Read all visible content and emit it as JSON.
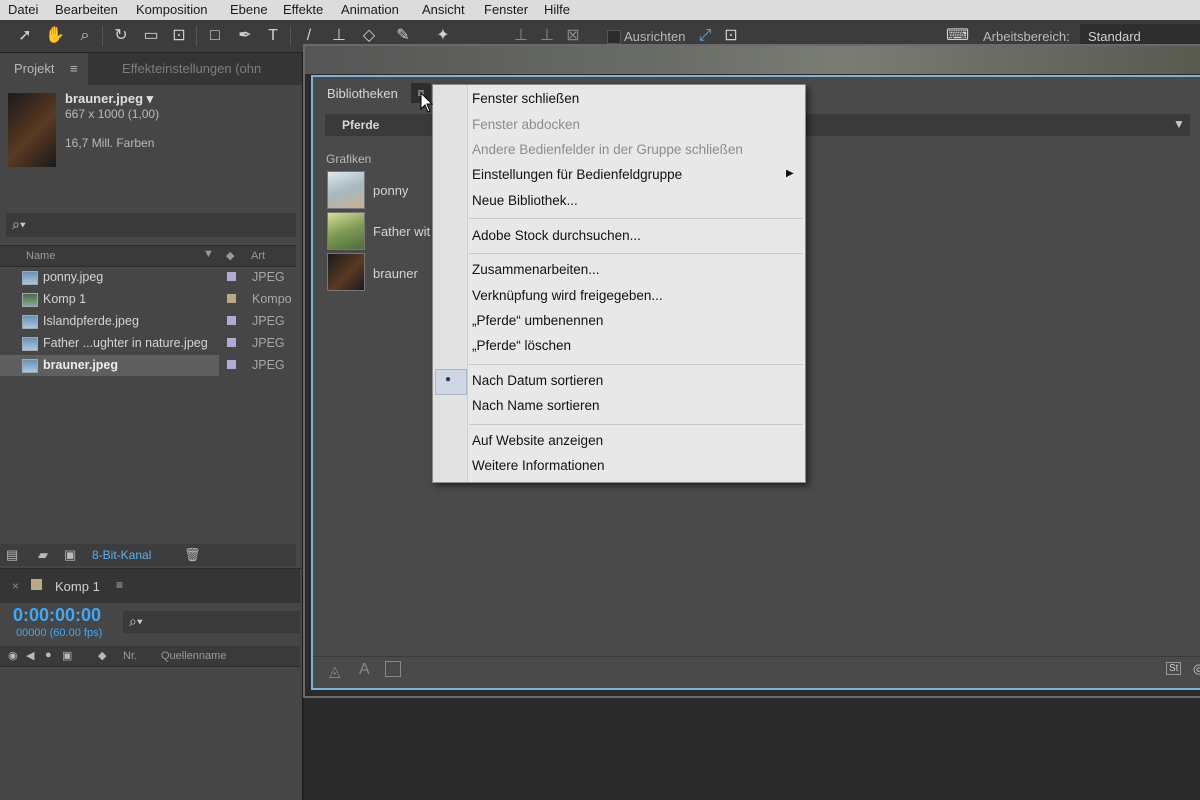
{
  "menubar": {
    "items": [
      "Datei",
      "Bearbeiten",
      "Komposition",
      "Ebene",
      "Effekte",
      "Animation",
      "Ansicht",
      "Fenster",
      "Hilfe"
    ]
  },
  "toolbar": {
    "align_label": "Ausrichten",
    "workspace_label": "Arbeitsbereich:",
    "workspace_value": "Standard"
  },
  "project": {
    "tab_project": "Projekt",
    "tab_effects": "Effekteinstellungen (ohn",
    "preview_name": "brauner.jpeg ▾",
    "preview_dims": "667 x 1000 (1,00)",
    "preview_colors": "16,7 Mill. Farben",
    "search_icon": "search-icon",
    "col_name": "Name",
    "col_type": "Art",
    "files": [
      {
        "name": "ponny.jpeg",
        "type": "JPEG"
      },
      {
        "name": "Komp 1",
        "type": "Kompo"
      },
      {
        "name": "Islandpferde.jpeg",
        "type": "JPEG"
      },
      {
        "name": "Father ...ughter in nature.jpeg",
        "type": "JPEG"
      },
      {
        "name": "brauner.jpeg",
        "type": "JPEG"
      }
    ],
    "bit_depth": "8-Bit-Kanal"
  },
  "timeline": {
    "comp_tab": "Komp 1",
    "timecode": "0:00:00:00",
    "frames": "00000 (60.00 fps)",
    "col_nr": "Nr.",
    "col_source": "Quellenname"
  },
  "libraries": {
    "title": "Bibliotheken",
    "selected_library": "Pferde",
    "section": "Grafiken",
    "items": [
      "ponny",
      "Father wit",
      "brauner"
    ]
  },
  "context_menu": {
    "items": [
      {
        "label": "Fenster schließen",
        "disabled": false
      },
      {
        "label": "Fenster abdocken",
        "disabled": true
      },
      {
        "label": "Andere Bedienfelder in der Gruppe schließen",
        "disabled": true
      },
      {
        "label": "Einstellungen für Bedienfeldgruppe",
        "disabled": false,
        "submenu": true
      },
      {
        "label": "Neue Bibliothek...",
        "disabled": false
      },
      {
        "label": "Adobe Stock durchsuchen...",
        "disabled": false
      },
      {
        "label": "Zusammenarbeiten...",
        "disabled": false
      },
      {
        "label": "Verknüpfung wird freigegeben...",
        "disabled": false
      },
      {
        "label": "„Pferde“ umbenennen",
        "disabled": false
      },
      {
        "label": "„Pferde“ löschen",
        "disabled": false
      },
      {
        "label": "Nach Datum sortieren",
        "disabled": false,
        "checked": true
      },
      {
        "label": "Nach Name sortieren",
        "disabled": false
      },
      {
        "label": "Auf Website anzeigen",
        "disabled": false
      },
      {
        "label": "Weitere Informationen",
        "disabled": false
      }
    ]
  },
  "colors": {
    "accent_blue": "#3fa9f5",
    "panel": "#464646",
    "menu_bg": "#e8e8e8"
  }
}
